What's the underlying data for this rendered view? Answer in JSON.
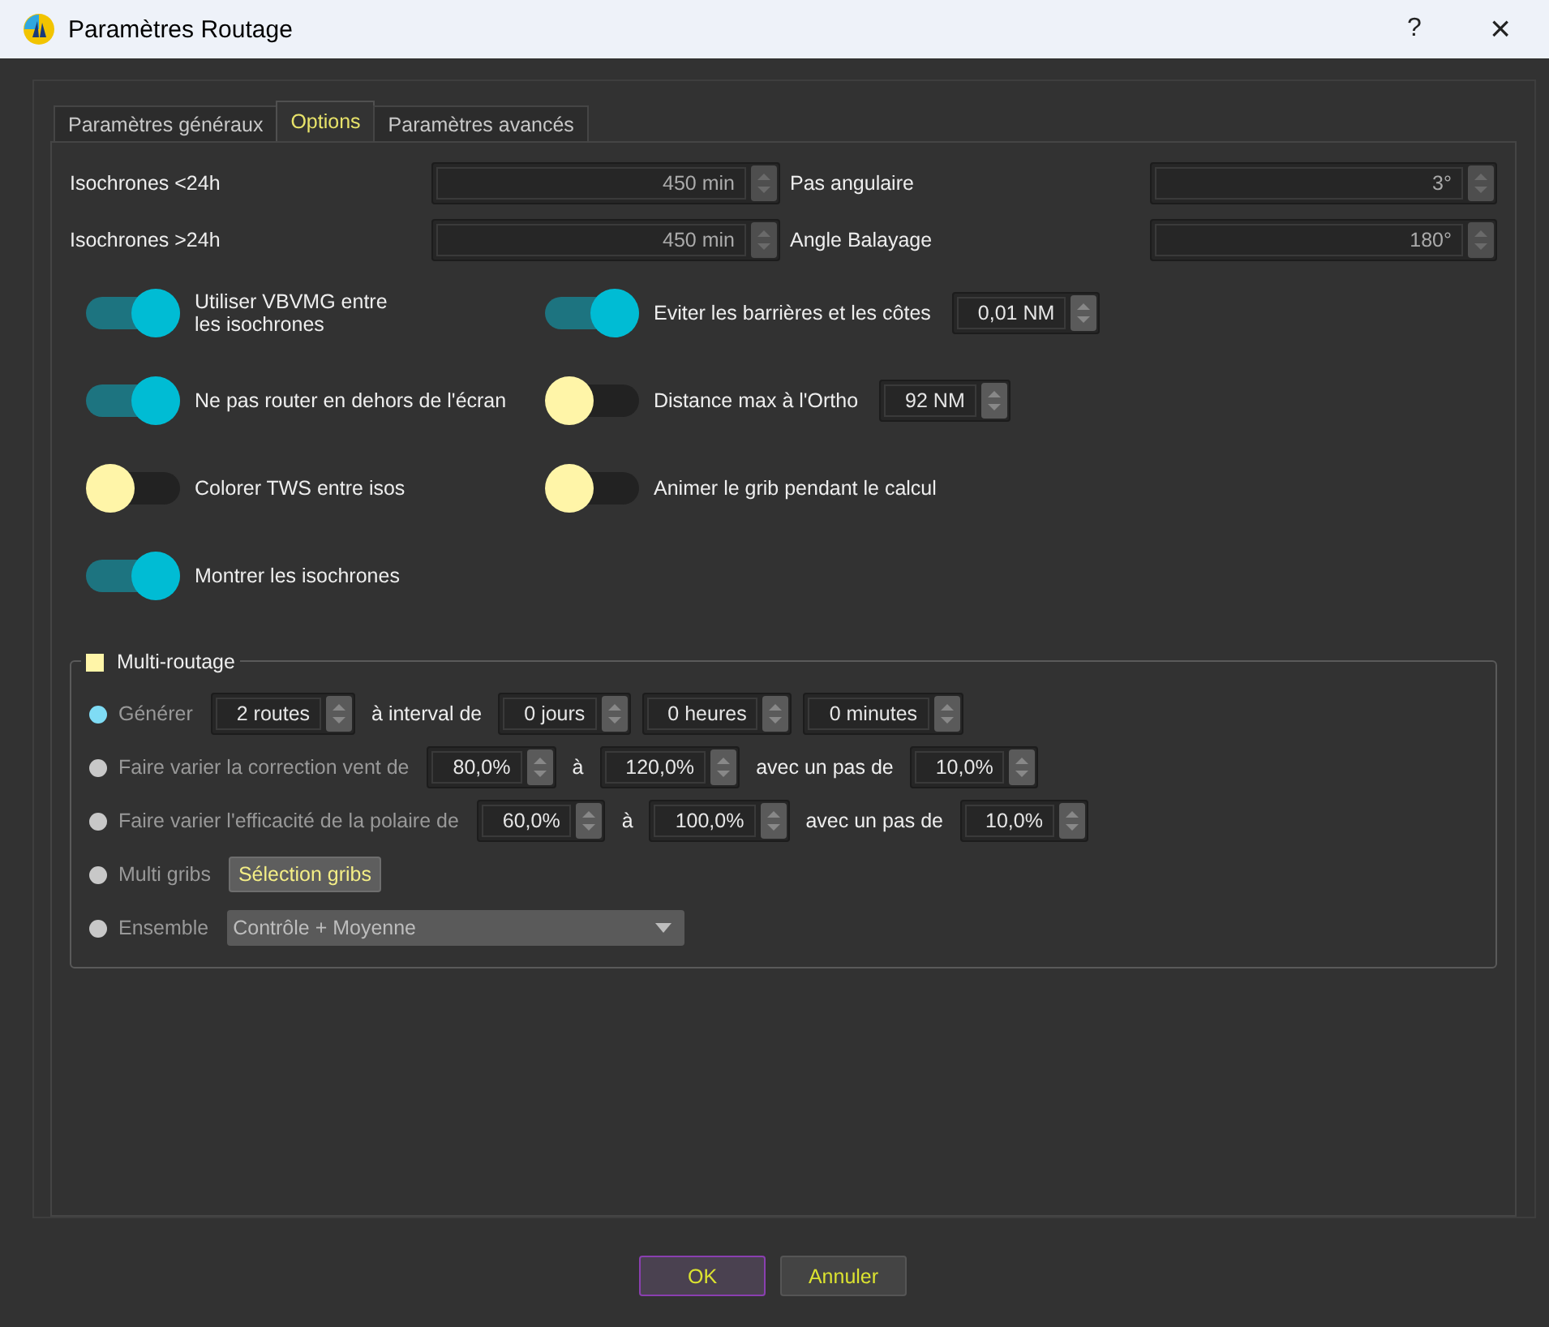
{
  "window": {
    "title": "Paramètres Routage",
    "help": "?",
    "close": "×"
  },
  "tabs": [
    {
      "label": "Paramètres généraux",
      "selected": false
    },
    {
      "label": "Options",
      "selected": true
    },
    {
      "label": "Paramètres avancés",
      "selected": false
    }
  ],
  "spin_fields": [
    {
      "label": "Isochrones <24h",
      "value": "450 min"
    },
    {
      "label": "Pas angulaire",
      "value": "3°"
    },
    {
      "label": "Isochrones >24h",
      "value": "450 min"
    },
    {
      "label": "Angle Balayage",
      "value": "180°"
    }
  ],
  "toggles": [
    {
      "label": "Utiliser VBVMG entre les isochrones",
      "on": true
    },
    {
      "label": "Eviter les barrières et les côtes",
      "on": true,
      "value": "0,01 NM"
    },
    {
      "label": "Ne pas router en dehors de l'écran",
      "on": true
    },
    {
      "label": "Distance max à l'Ortho",
      "on": false,
      "value": "92 NM"
    },
    {
      "label": "Colorer TWS entre isos",
      "on": false
    },
    {
      "label": "Animer le grib pendant le calcul",
      "on": false
    },
    {
      "label": "Montrer les isochrones",
      "on": true
    }
  ],
  "multi_routage": {
    "title": "Multi-routage",
    "checked": false,
    "options": [
      {
        "label": "Générer",
        "selected": true,
        "parts": [
          {
            "kind": "spin",
            "value": "2 routes"
          },
          {
            "kind": "text",
            "text": "à interval de"
          },
          {
            "kind": "spin",
            "value": "0 jours"
          },
          {
            "kind": "spin",
            "value": "0 heures"
          },
          {
            "kind": "spin",
            "value": "0 minutes"
          }
        ]
      },
      {
        "label": "Faire varier la correction vent de",
        "selected": false,
        "parts": [
          {
            "kind": "spin",
            "value": "80,0%"
          },
          {
            "kind": "text",
            "text": "à"
          },
          {
            "kind": "spin",
            "value": "120,0%"
          },
          {
            "kind": "text",
            "text": "avec un pas de"
          },
          {
            "kind": "spin",
            "value": "10,0%"
          }
        ]
      },
      {
        "label": "Faire varier l'efficacité de la polaire de",
        "selected": false,
        "parts": [
          {
            "kind": "spin",
            "value": "60,0%"
          },
          {
            "kind": "text",
            "text": "à"
          },
          {
            "kind": "spin",
            "value": "100,0%"
          },
          {
            "kind": "text",
            "text": "avec un pas de"
          },
          {
            "kind": "spin",
            "value": "10,0%"
          }
        ]
      },
      {
        "label": "Multi gribs",
        "selected": false,
        "parts": [
          {
            "kind": "button",
            "label": "Sélection gribs"
          }
        ]
      },
      {
        "label": "Ensemble",
        "selected": false,
        "parts": [
          {
            "kind": "combo",
            "value": "Contrôle + Moyenne"
          }
        ]
      }
    ]
  },
  "buttons": [
    {
      "label": "OK",
      "default": true
    },
    {
      "label": "Annuler",
      "default": false
    }
  ]
}
